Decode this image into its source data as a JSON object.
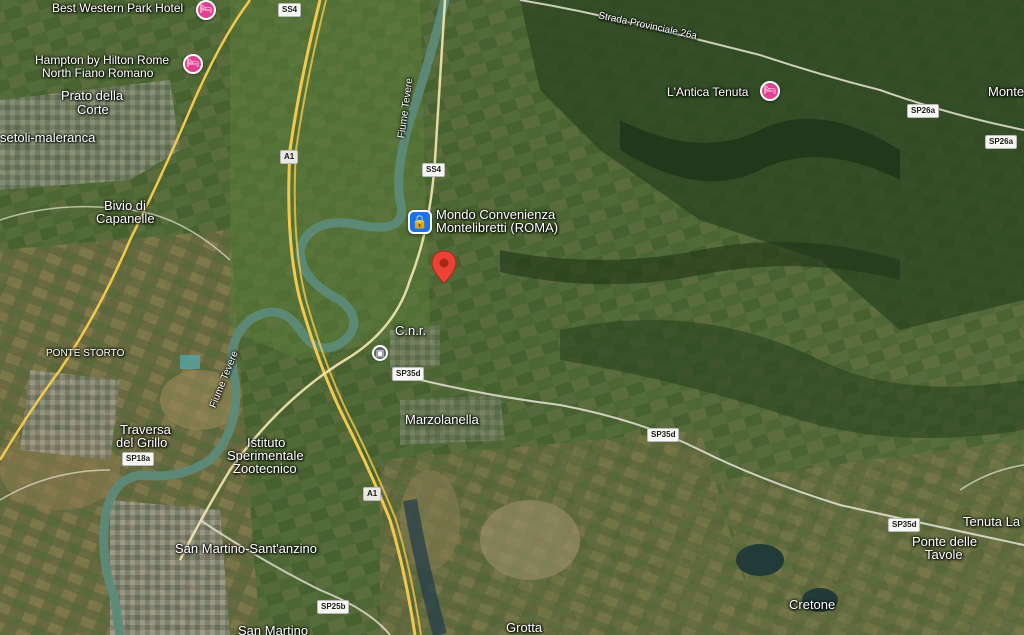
{
  "map": {
    "type": "satellite",
    "colors": {
      "field_green": "#3d5a2a",
      "dark_forest": "#1f3318",
      "river": "#5d8a78",
      "road_yellow": "#f2c94c",
      "pin_red": "#ea4335",
      "hotel_pink": "#e1418f",
      "store_blue": "#1a73e8"
    }
  },
  "places": {
    "best_western": "Best Western Park Hotel",
    "hampton_line1": "Hampton by Hilton Rome",
    "hampton_line2": "North Fiano Romano",
    "prato_line1": "Prato della",
    "prato_line2": "Corte",
    "setoli": "setoli-maleranca",
    "bivio_line1": "Bivio di",
    "bivio_line2": "Capanelle",
    "ponte_storto": "PONTE STORTO",
    "traversa_line1": "Traversa",
    "traversa_line2": "del Grillo",
    "istituto_line1": "Istituto",
    "istituto_line2": "Sperimentale",
    "istituto_line3": "Zootecnico",
    "san_martino_santanzino": "San Martino-Sant'anzino",
    "san_martino": "San Martino",
    "mondo_line1": "Mondo Convenienza",
    "mondo_line2": "Montelibretti (ROMA)",
    "cnr": "C.n.r.",
    "marzolanella": "Marzolanella",
    "antica_tenuta": "L'Antica Tenuta",
    "monte": "Monte",
    "tenuta_la": "Tenuta La S",
    "ponte_tavole_line1": "Ponte delle",
    "ponte_tavole_line2": "Tavole",
    "cretone": "Cretone",
    "grotta": "Grotta"
  },
  "roads": {
    "fiume_tevere_north": "Fiume Tevere",
    "fiume_tevere_south": "Fiume Tevere",
    "strada_provinciale": "Strada Provinciale 26a"
  },
  "shields": {
    "ss4_top": "SS4",
    "ss4_mid": "SS4",
    "a1_north": "A1",
    "a1_south": "A1",
    "sp26a_1": "SP26a",
    "sp26a_2": "SP26a",
    "sp35d_1": "SP35d",
    "sp35d_2": "SP35d",
    "sp35d_3": "SP35d",
    "sp18a": "SP18a",
    "sp25b": "SP25b"
  },
  "icons": {
    "hotel": "bed-icon",
    "store": "shopping-bag-icon",
    "train": "train-icon",
    "pin": "red-location-pin"
  }
}
